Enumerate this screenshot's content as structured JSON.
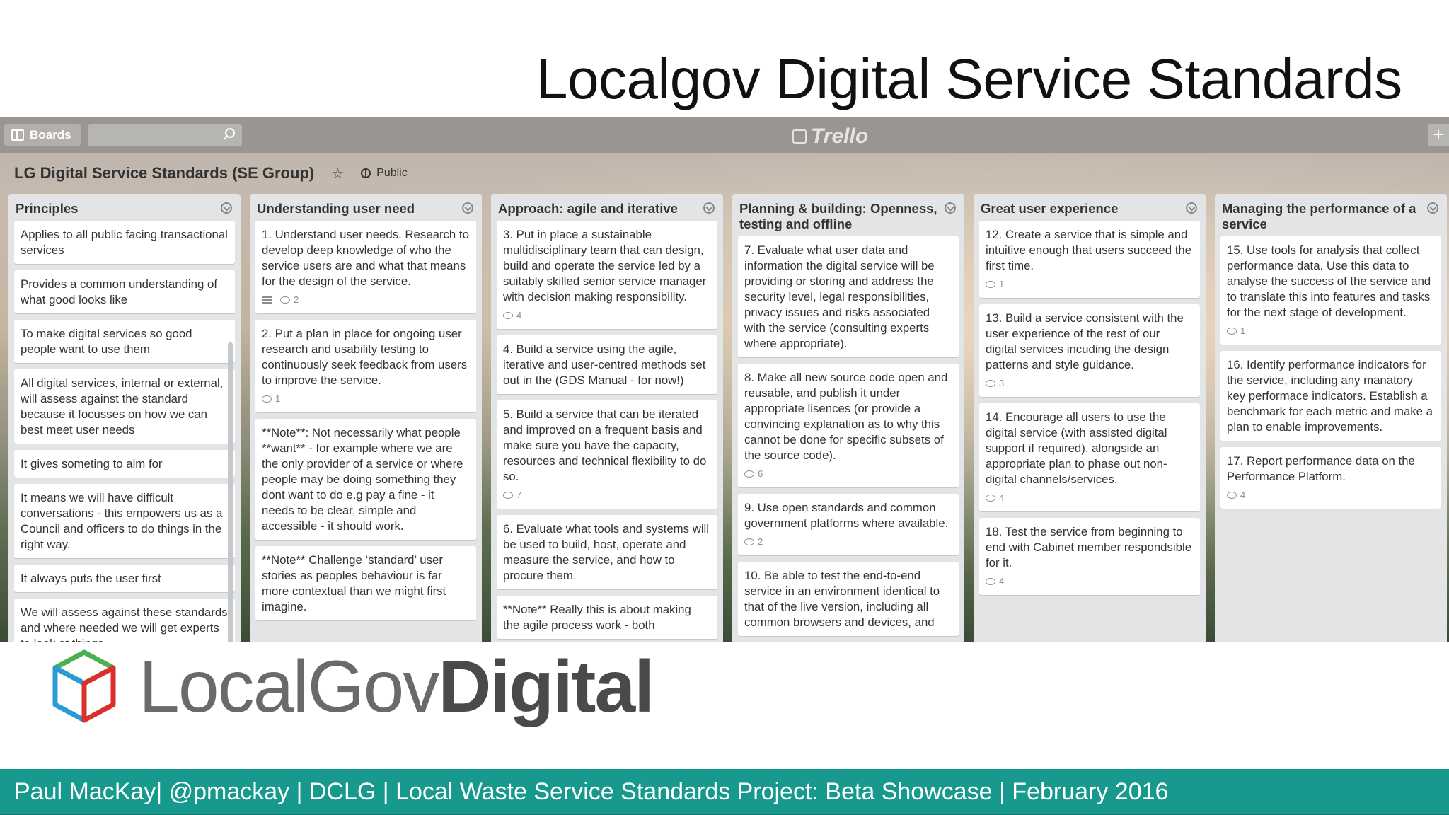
{
  "slide": {
    "title": "Localgov Digital Service Standards",
    "footer": "Paul MacKay| @pmackay | DCLG | Local Waste Service Standards Project: Beta Showcase | February 2016",
    "logo": {
      "light": "LocalGov",
      "bold": "Digital"
    }
  },
  "trello": {
    "boards_label": "Boards",
    "logo_text": "Trello",
    "board_title": "LG Digital Service Standards (SE Group)",
    "visibility": "Public",
    "lists": [
      {
        "title": "Principles",
        "cards": [
          {
            "text": "Applies to all public facing transactional services"
          },
          {
            "text": "Provides a common understanding of what good looks like"
          },
          {
            "text": "To make digital services so good people want to use them"
          },
          {
            "text": "All digital services, internal or external, will assess against the standard because it focusses on how we can best meet user needs"
          },
          {
            "text": "It gives someting to aim for"
          },
          {
            "text": "It means we will have difficult conversations - this empowers us as a Council and officers to do things in the right way."
          },
          {
            "text": "It always puts the user first"
          },
          {
            "text": "We will assess against these standards and where needed we will get experts to look at things"
          }
        ]
      },
      {
        "title": "Understanding user need",
        "cards": [
          {
            "text": "1. Understand user needs. Research to develop deep knowledge of who the service users are and what that means for the design of the service.",
            "desc": true,
            "comments": "2"
          },
          {
            "text": "2. Put a plan in place for ongoing user research and usability testing to continuously seek feedback from users to improve the service.",
            "comments": "1"
          },
          {
            "text": "**Note**: Not necessarily what people **want** - for example where we are the only provider of a service or where people may be doing something they dont want to do e.g pay a fine - it needs to be clear, simple and accessible - it should work."
          },
          {
            "text": "**Note** Challenge ‘standard’ user stories as peoples behaviour is far more contextual than we might first imagine."
          }
        ]
      },
      {
        "title": "Approach: agile and iterative",
        "cards": [
          {
            "text": "3. Put in place a sustainable multidisciplinary team that can design, build and operate the service led by a suitably skilled senior service manager with decision making responsibility.",
            "comments": "4"
          },
          {
            "text": "4. Build a service using the agile, iterative and user-centred methods set out in the (GDS Manual - for now!)"
          },
          {
            "text": "5. Build a service that can be iterated and improved on a frequent basis and make sure you have the capacity, resources and technical flexibility to do so.",
            "comments": "7"
          },
          {
            "text": "6. Evaluate what tools and systems will be used to build, host, operate and measure the service, and how to procure them."
          },
          {
            "text": "**Note** Really this is about making the agile process work - both"
          }
        ]
      },
      {
        "title": "Planning & building: Openness, testing and offline",
        "cards": [
          {
            "text": "7. Evaluate what user data and information the digital service will be providing or storing and address the security level, legal responsibilities, privacy issues and risks associated with the service (consulting experts where appropriate)."
          },
          {
            "text": "8. Make all new source code open and reusable, and publish it under appropriate lisences (or provide a convincing explanation as to why this cannot be done for specific subsets of the source code).",
            "comments": "6"
          },
          {
            "text": "9. Use open standards and common government platforms where available.",
            "comments": "2"
          },
          {
            "text": "10. Be able to test the end-to-end service in an environment identical to that of the live version, including all common browsers and devices, and"
          }
        ]
      },
      {
        "title": "Great user experience",
        "cards": [
          {
            "text": "12. Create a service that is simple and intuitive enough that users succeed the first time.",
            "comments": "1"
          },
          {
            "text": "13. Build a service consistent with the user experience of the rest of our digital services incuding the design patterns and style guidance.",
            "comments": "3"
          },
          {
            "text": "14. Encourage all users to use the digital service (with assisted digital support if required), alongside an appropriate plan to phase out non-digital channels/services.",
            "comments": "4"
          },
          {
            "text": "18. Test the service from beginning to end with Cabinet member respondsible for it.",
            "comments": "4"
          }
        ]
      },
      {
        "title": "Managing the performance of a service",
        "cards": [
          {
            "text": "15. Use tools for analysis that collect performance data. Use this data to analyse the success of the service and to translate this into features and tasks for the next stage of development.",
            "comments": "1"
          },
          {
            "text": "16. Identify performance indicators for the service, including any manatory key performace indicators. Establish a benchmark for each metric and make a plan to enable improvements."
          },
          {
            "text": "17. Report performance data on the Performance Platform.",
            "comments": "4"
          }
        ]
      }
    ]
  }
}
